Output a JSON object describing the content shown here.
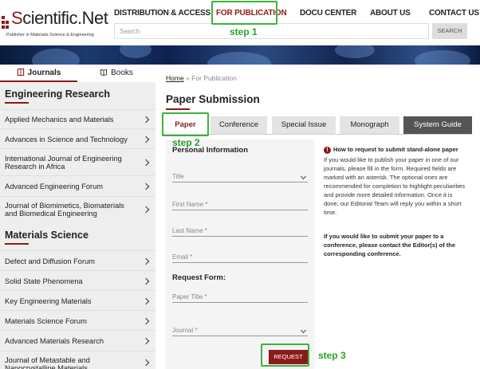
{
  "logo": {
    "brand_prefix": "S",
    "brand_text": "cientific.Net",
    "tagline": "Publisher in Materials Science & Engineering"
  },
  "nav": {
    "items": [
      {
        "label": "DISTRIBUTION & ACCESS"
      },
      {
        "label": "FOR PUBLICATION"
      },
      {
        "label": "DOCU CENTER"
      },
      {
        "label": "ABOUT US"
      },
      {
        "label": "CONTACT US"
      }
    ]
  },
  "search": {
    "placeholder": "Search",
    "button_label": "SEARCH"
  },
  "sidebar": {
    "tabs": [
      {
        "label": "Journals"
      },
      {
        "label": "Books"
      }
    ],
    "sections": [
      {
        "heading": "Engineering Research",
        "items": [
          {
            "label": "Applied Mechanics and Materials"
          },
          {
            "label": "Advances in Science and Technology"
          },
          {
            "label": "International Journal of Engineering Research in Africa"
          },
          {
            "label": "Advanced Engineering Forum"
          },
          {
            "label": "Journal of Biomimetics, Biomaterials and Biomedical Engineering"
          }
        ]
      },
      {
        "heading": "Materials Science",
        "items": [
          {
            "label": "Defect and Diffusion Forum"
          },
          {
            "label": "Solid State Phenomena"
          },
          {
            "label": "Key Engineering Materials"
          },
          {
            "label": "Materials Science Forum"
          },
          {
            "label": "Advanced Materials Research"
          },
          {
            "label": "Journal of Metastable and Nanocrystalline Materials"
          }
        ]
      }
    ]
  },
  "breadcrumb": {
    "home": "Home",
    "separator": "»",
    "current": "For Publication"
  },
  "page_title": "Paper Submission",
  "tabs": [
    {
      "label": "Paper"
    },
    {
      "label": "Conference"
    },
    {
      "label": "Special Issue"
    },
    {
      "label": "Monograph"
    },
    {
      "label": "System Guide"
    }
  ],
  "form": {
    "personal_heading": "Personal Information",
    "fields": {
      "title": "Title",
      "first_name": "First Name *",
      "last_name": "Last Name *",
      "email": "Email *",
      "paper_title": "Paper Title *",
      "journal": "Journal *"
    },
    "request_heading": "Request Form:",
    "submit_label": "REQUEST"
  },
  "info": {
    "icon_glyph": "!",
    "title": "How to request to submit stand-alone paper",
    "body": "If you would like to publish your paper in one of our journals, please fill in the form. Required fields are marked with an asterisk. The optional ones are recommended for completion to highlight peculiarities and provide more detailed information. Once it is done, our Editorial Team will reply you within a short time.",
    "conference_note": "If you would like to submit your paper to a conference, please contact the Editor(s) of the corresponding conference."
  },
  "annotations": {
    "step1": "step 1",
    "step2": "step 2",
    "step3": "step 3",
    "color": "#3bb33b"
  },
  "colors": {
    "accent": "#8b1a1a",
    "tab_dark": "#555555"
  }
}
